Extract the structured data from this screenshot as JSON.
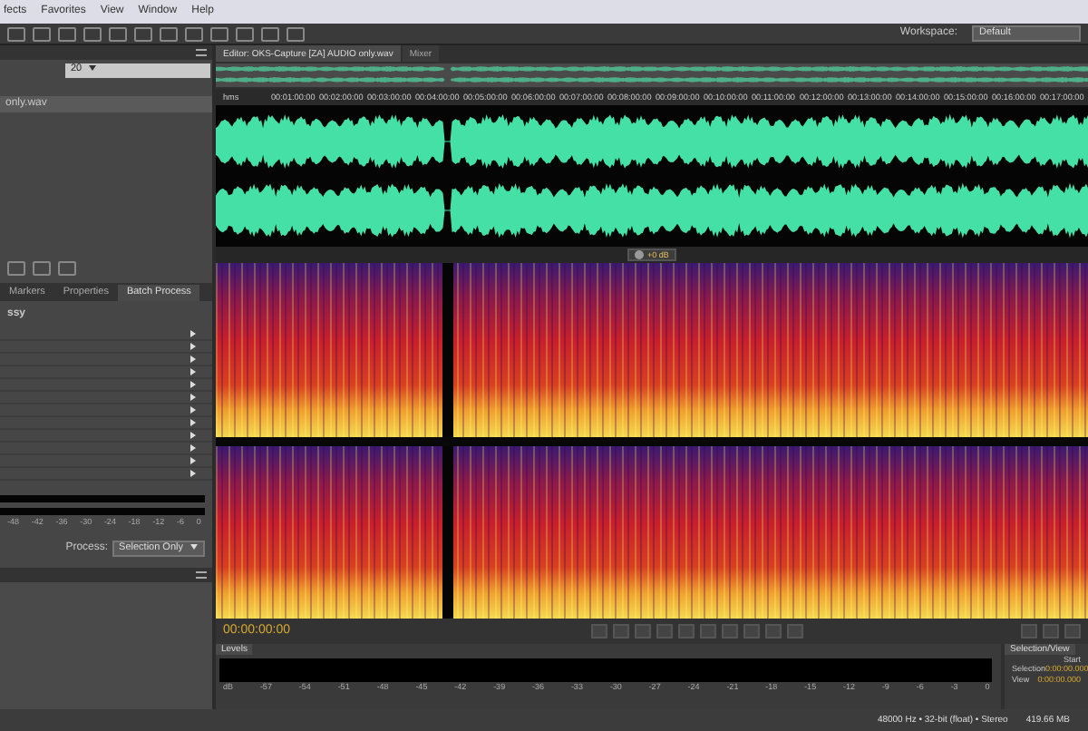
{
  "menu": [
    "fects",
    "Favorites",
    "View",
    "Window",
    "Help"
  ],
  "workspace": {
    "label": "Workspace:",
    "value": "Default"
  },
  "files_panel": {
    "dropdown": "20",
    "file": "only.wav"
  },
  "left_tabs": [
    {
      "label": "Markers",
      "selected": false
    },
    {
      "label": "Properties",
      "selected": false
    },
    {
      "label": "Batch Process",
      "selected": true
    }
  ],
  "batch_heading": "ssy",
  "meter_ticks": [
    "-48",
    "-42",
    "-36",
    "-30",
    "-24",
    "-18",
    "-12",
    "-6",
    "0"
  ],
  "process": {
    "label": "Process:",
    "value": "Selection Only"
  },
  "editor_tabs": [
    {
      "label": "Editor: OKS-Capture [ZA] AUDIO only.wav",
      "selected": true
    },
    {
      "label": "Mixer",
      "selected": false
    }
  ],
  "timeline": {
    "start": "hms",
    "ticks": [
      "00:01:00:00",
      "00:02:00:00",
      "00:03:00:00",
      "00:04:00:00",
      "00:05:00:00",
      "00:06:00:00",
      "00:07:00:00",
      "00:08:00:00",
      "00:09:00:00",
      "00:10:00:00",
      "00:11:00:00",
      "00:12:00:00",
      "00:13:00:00",
      "00:14:00:00",
      "00:15:00:00",
      "00:16:00:00",
      "00:17:00:00"
    ]
  },
  "hud_readout": "+0 dB",
  "time_display": "00:00:00:00",
  "levels_panel": {
    "title": "Levels",
    "ticks": [
      "dB",
      "-57",
      "-54",
      "-51",
      "-48",
      "-45",
      "-42",
      "-39",
      "-36",
      "-33",
      "-30",
      "-27",
      "-24",
      "-21",
      "-18",
      "-15",
      "-12",
      "-9",
      "-6",
      "-3",
      "0"
    ]
  },
  "selection_view": {
    "title": "Selection/View",
    "column": "Start",
    "rows": [
      {
        "label": "Selection",
        "start": "0:00:00.000"
      },
      {
        "label": "View",
        "start": "0:00:00.000"
      }
    ]
  },
  "status_bar": [
    "48000 Hz • 32-bit (float) • Stereo",
    "419.66 MB"
  ]
}
